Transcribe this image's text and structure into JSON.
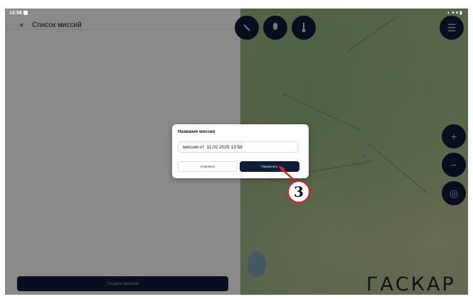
{
  "status_bar": {
    "time": "13:58",
    "icons": "◐ ▾ ▾ ▮"
  },
  "left_panel": {
    "close_icon": "×",
    "title": "Список миссий",
    "create_button_label": "Создать миссию"
  },
  "map": {
    "logo_text": "ГАСКАР",
    "zoom_in_label": "+",
    "zoom_out_label": "−",
    "locate_label": "◎",
    "layers_label": "☰"
  },
  "dialog": {
    "title": "Название миссии",
    "input_value": "миссия от  11.02.2025 13:58",
    "cancel_label": "Отменить",
    "apply_label": "Применить"
  },
  "callout": {
    "number": "3",
    "color": "#d62222"
  },
  "colors": {
    "primary": "#0e1b3a",
    "accent_red": "#d62222"
  }
}
